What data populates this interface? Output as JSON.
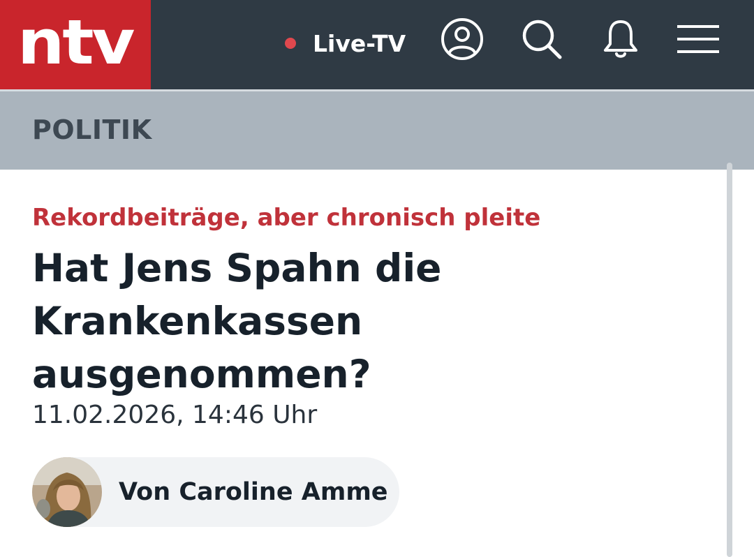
{
  "header": {
    "logo_text": "ntv",
    "live_label": "Live-TV",
    "icons": [
      "user-account-icon",
      "search-icon",
      "bell-icon",
      "menu-icon"
    ],
    "colors": {
      "brand_red": "#c9252c",
      "header_bg": "#2f3a44",
      "live_dot": "#e0484e"
    }
  },
  "section": {
    "label": "POLITIK",
    "bg_color": "#aab4bd"
  },
  "article": {
    "kicker": "Rekordbeiträge, aber chronisch pleite",
    "headline": "Hat Jens Spahn die Krankenkassen ausgenommen?",
    "date": "11.02.2026, 14:46 Uhr",
    "author": {
      "name": "Von Caroline Amme"
    },
    "colors": {
      "kicker": "#c0323a",
      "headline": "#17212b"
    }
  }
}
